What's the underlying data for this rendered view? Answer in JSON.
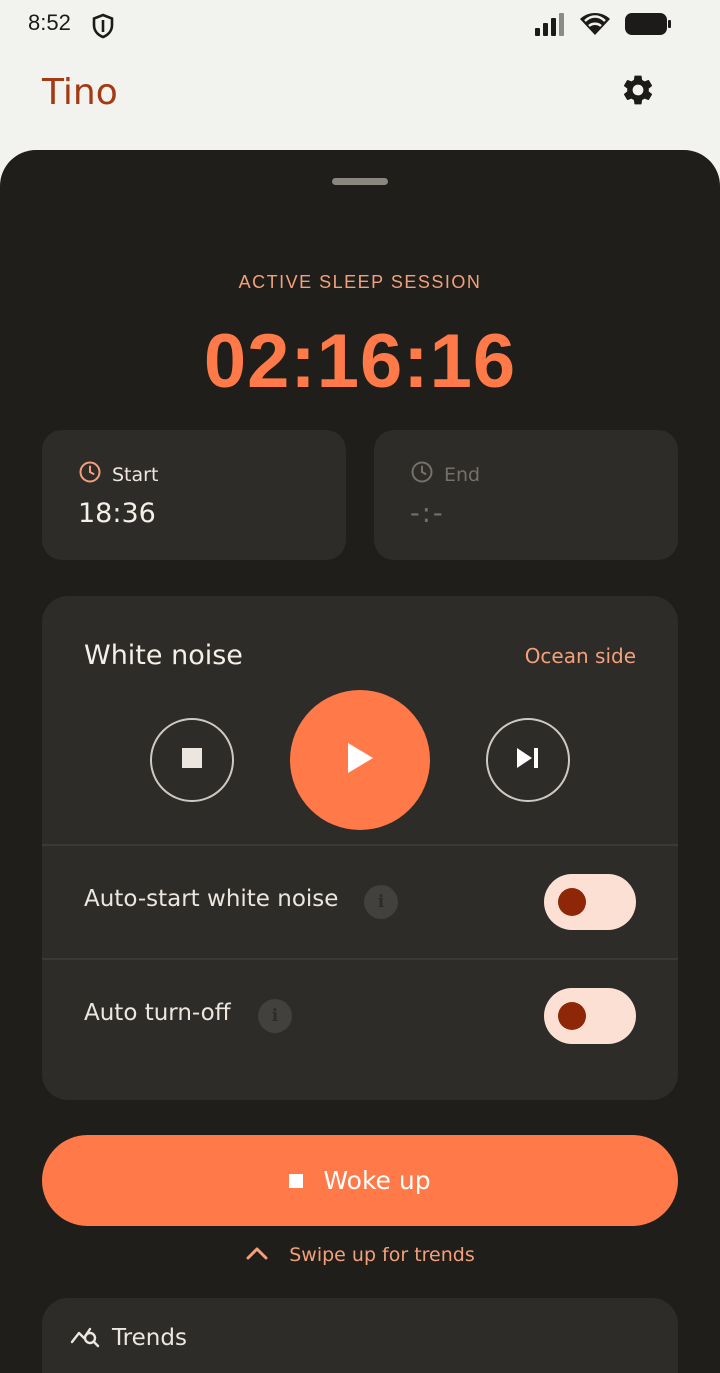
{
  "status_bar": {
    "time": "8:52",
    "icons": [
      "shield-icon",
      "signal-icon",
      "wifi-icon",
      "battery-icon"
    ]
  },
  "app_bar": {
    "title": "Tino",
    "settings_icon": "gear-icon"
  },
  "session": {
    "label": "ACTIVE SLEEP SESSION",
    "elapsed": "02:16:16",
    "start": {
      "label": "Start",
      "value": "18:36",
      "icon": "clock-icon"
    },
    "end": {
      "label": "End",
      "value": "-:-",
      "icon": "clock-icon"
    }
  },
  "white_noise": {
    "title": "White noise",
    "track": "Ocean side",
    "controls": [
      "stop-icon",
      "play-icon",
      "skip-next-icon"
    ],
    "auto_start": {
      "label": "Auto-start white noise",
      "enabled": false
    },
    "auto_off": {
      "label": "Auto turn-off",
      "enabled": false
    }
  },
  "woke_button": {
    "label": "Woke up"
  },
  "swipe_hint": "Swipe up for trends",
  "trends": {
    "title": "Trends",
    "icon": "trends-icon"
  },
  "colors": {
    "accent": "#ff7a48",
    "brand": "#a33a14",
    "sheet_bg": "#1f1e1b",
    "card_bg": "#2d2c29",
    "toggle_track": "#fde0d4",
    "toggle_knob": "#8e2708"
  }
}
